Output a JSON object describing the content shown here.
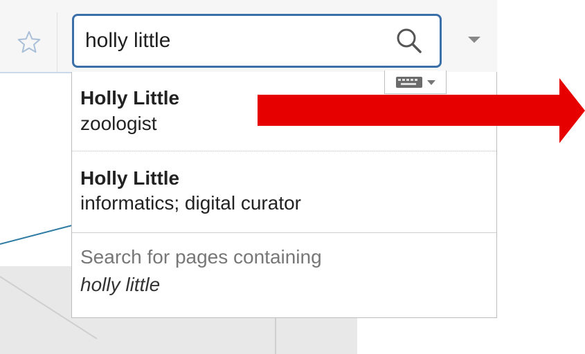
{
  "search": {
    "value": "holly little",
    "placeholder": ""
  },
  "suggestions": [
    {
      "title": "Holly Little",
      "description": "zoologist"
    },
    {
      "title": "Holly Little",
      "description": "informatics; digital curator"
    }
  ],
  "search_pages": {
    "lead": "Search for pages containing",
    "query": "holly little"
  },
  "icons": {
    "star": "star-icon",
    "search": "search-icon",
    "dropdown": "chevron-down-icon",
    "keyboard": "keyboard-icon",
    "arrow": "arrow-right-icon"
  },
  "colors": {
    "search_border": "#3a6fa8",
    "arrow": "#e60000",
    "muted_text": "#777777"
  }
}
